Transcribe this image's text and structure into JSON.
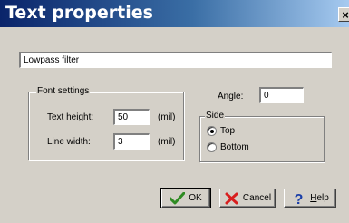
{
  "window": {
    "title": "Text properties",
    "close_glyph": "×"
  },
  "text_field": {
    "value": "Lowpass filter"
  },
  "font_settings": {
    "label": "Font settings",
    "text_height": {
      "label": "Text height:",
      "value": "50",
      "unit": "(mil)"
    },
    "line_width": {
      "label": "Line width:",
      "value": "3",
      "unit": "(mil)"
    }
  },
  "angle": {
    "label": "Angle:",
    "value": "0"
  },
  "side": {
    "label": "Side",
    "options": [
      {
        "label": "Top",
        "selected": true
      },
      {
        "label": "Bottom",
        "selected": false
      }
    ]
  },
  "buttons": {
    "ok": {
      "label": "OK",
      "icon": "checkmark-icon"
    },
    "cancel": {
      "label": "Cancel",
      "icon": "cross-icon"
    },
    "help": {
      "label_underlined": "H",
      "label_rest": "elp",
      "icon": "question-icon"
    }
  },
  "colors": {
    "title_start": "#0a246a",
    "title_end": "#a6caf0",
    "face": "#d4d0c8",
    "ok_check": "#2e8b22",
    "cancel_x": "#d81e1e",
    "help_q": "#1a3ea8"
  }
}
